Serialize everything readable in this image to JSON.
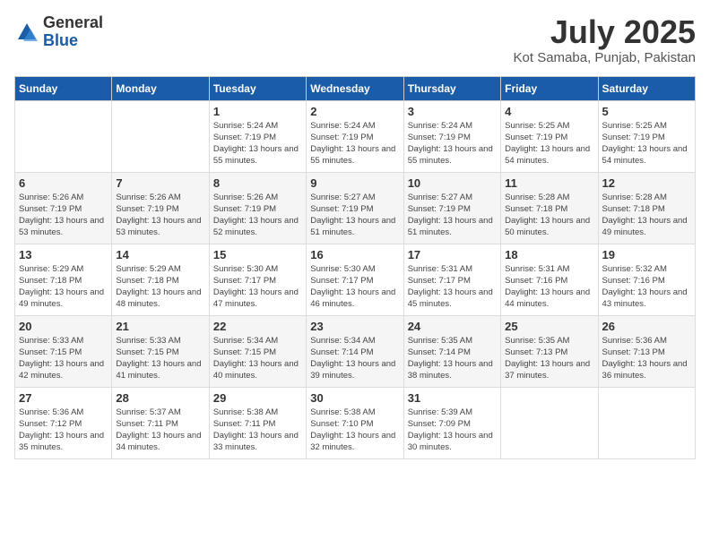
{
  "logo": {
    "general": "General",
    "blue": "Blue"
  },
  "title": "July 2025",
  "subtitle": "Kot Samaba, Punjab, Pakistan",
  "days_of_week": [
    "Sunday",
    "Monday",
    "Tuesday",
    "Wednesday",
    "Thursday",
    "Friday",
    "Saturday"
  ],
  "weeks": [
    [
      {
        "day": "",
        "info": ""
      },
      {
        "day": "",
        "info": ""
      },
      {
        "day": "1",
        "info": "Sunrise: 5:24 AM\nSunset: 7:19 PM\nDaylight: 13 hours and 55 minutes."
      },
      {
        "day": "2",
        "info": "Sunrise: 5:24 AM\nSunset: 7:19 PM\nDaylight: 13 hours and 55 minutes."
      },
      {
        "day": "3",
        "info": "Sunrise: 5:24 AM\nSunset: 7:19 PM\nDaylight: 13 hours and 55 minutes."
      },
      {
        "day": "4",
        "info": "Sunrise: 5:25 AM\nSunset: 7:19 PM\nDaylight: 13 hours and 54 minutes."
      },
      {
        "day": "5",
        "info": "Sunrise: 5:25 AM\nSunset: 7:19 PM\nDaylight: 13 hours and 54 minutes."
      }
    ],
    [
      {
        "day": "6",
        "info": "Sunrise: 5:26 AM\nSunset: 7:19 PM\nDaylight: 13 hours and 53 minutes."
      },
      {
        "day": "7",
        "info": "Sunrise: 5:26 AM\nSunset: 7:19 PM\nDaylight: 13 hours and 53 minutes."
      },
      {
        "day": "8",
        "info": "Sunrise: 5:26 AM\nSunset: 7:19 PM\nDaylight: 13 hours and 52 minutes."
      },
      {
        "day": "9",
        "info": "Sunrise: 5:27 AM\nSunset: 7:19 PM\nDaylight: 13 hours and 51 minutes."
      },
      {
        "day": "10",
        "info": "Sunrise: 5:27 AM\nSunset: 7:19 PM\nDaylight: 13 hours and 51 minutes."
      },
      {
        "day": "11",
        "info": "Sunrise: 5:28 AM\nSunset: 7:18 PM\nDaylight: 13 hours and 50 minutes."
      },
      {
        "day": "12",
        "info": "Sunrise: 5:28 AM\nSunset: 7:18 PM\nDaylight: 13 hours and 49 minutes."
      }
    ],
    [
      {
        "day": "13",
        "info": "Sunrise: 5:29 AM\nSunset: 7:18 PM\nDaylight: 13 hours and 49 minutes."
      },
      {
        "day": "14",
        "info": "Sunrise: 5:29 AM\nSunset: 7:18 PM\nDaylight: 13 hours and 48 minutes."
      },
      {
        "day": "15",
        "info": "Sunrise: 5:30 AM\nSunset: 7:17 PM\nDaylight: 13 hours and 47 minutes."
      },
      {
        "day": "16",
        "info": "Sunrise: 5:30 AM\nSunset: 7:17 PM\nDaylight: 13 hours and 46 minutes."
      },
      {
        "day": "17",
        "info": "Sunrise: 5:31 AM\nSunset: 7:17 PM\nDaylight: 13 hours and 45 minutes."
      },
      {
        "day": "18",
        "info": "Sunrise: 5:31 AM\nSunset: 7:16 PM\nDaylight: 13 hours and 44 minutes."
      },
      {
        "day": "19",
        "info": "Sunrise: 5:32 AM\nSunset: 7:16 PM\nDaylight: 13 hours and 43 minutes."
      }
    ],
    [
      {
        "day": "20",
        "info": "Sunrise: 5:33 AM\nSunset: 7:15 PM\nDaylight: 13 hours and 42 minutes."
      },
      {
        "day": "21",
        "info": "Sunrise: 5:33 AM\nSunset: 7:15 PM\nDaylight: 13 hours and 41 minutes."
      },
      {
        "day": "22",
        "info": "Sunrise: 5:34 AM\nSunset: 7:15 PM\nDaylight: 13 hours and 40 minutes."
      },
      {
        "day": "23",
        "info": "Sunrise: 5:34 AM\nSunset: 7:14 PM\nDaylight: 13 hours and 39 minutes."
      },
      {
        "day": "24",
        "info": "Sunrise: 5:35 AM\nSunset: 7:14 PM\nDaylight: 13 hours and 38 minutes."
      },
      {
        "day": "25",
        "info": "Sunrise: 5:35 AM\nSunset: 7:13 PM\nDaylight: 13 hours and 37 minutes."
      },
      {
        "day": "26",
        "info": "Sunrise: 5:36 AM\nSunset: 7:13 PM\nDaylight: 13 hours and 36 minutes."
      }
    ],
    [
      {
        "day": "27",
        "info": "Sunrise: 5:36 AM\nSunset: 7:12 PM\nDaylight: 13 hours and 35 minutes."
      },
      {
        "day": "28",
        "info": "Sunrise: 5:37 AM\nSunset: 7:11 PM\nDaylight: 13 hours and 34 minutes."
      },
      {
        "day": "29",
        "info": "Sunrise: 5:38 AM\nSunset: 7:11 PM\nDaylight: 13 hours and 33 minutes."
      },
      {
        "day": "30",
        "info": "Sunrise: 5:38 AM\nSunset: 7:10 PM\nDaylight: 13 hours and 32 minutes."
      },
      {
        "day": "31",
        "info": "Sunrise: 5:39 AM\nSunset: 7:09 PM\nDaylight: 13 hours and 30 minutes."
      },
      {
        "day": "",
        "info": ""
      },
      {
        "day": "",
        "info": ""
      }
    ]
  ]
}
